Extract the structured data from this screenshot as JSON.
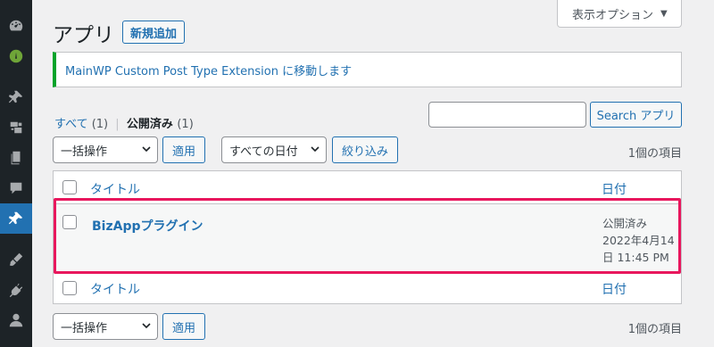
{
  "sidebar": {
    "items": [
      {
        "icon": "dashboard-icon"
      },
      {
        "icon": "mainwp-icon"
      },
      {
        "icon": "posts-pin-icon"
      },
      {
        "icon": "media-icon"
      },
      {
        "icon": "pages-icon"
      },
      {
        "icon": "comments-icon"
      },
      {
        "icon": "apps-pin-icon",
        "active": true
      },
      {
        "icon": "appearance-icon"
      },
      {
        "icon": "plugins-icon"
      },
      {
        "icon": "users-icon"
      }
    ],
    "active_color": "#2271b1"
  },
  "screen_options": {
    "label": "表示オプション",
    "arrow": "▼"
  },
  "header": {
    "title": "アプリ",
    "add_new_label": "新規追加"
  },
  "notice": {
    "text": "MainWP Custom Post Type Extension に移動します",
    "accent_color": "#00a32a"
  },
  "views": {
    "all": {
      "label": "すべて",
      "count": "(1)"
    },
    "separator": "|",
    "published": {
      "label": "公開済み",
      "count": "(1)"
    }
  },
  "search": {
    "value": "",
    "button_label": "Search アプリ"
  },
  "top_nav": {
    "bulk_action": "一括操作",
    "apply_label": "適用",
    "date_filter": "すべての日付",
    "filter_label": "絞り込み",
    "items_count": "1個の項目"
  },
  "table": {
    "columns": {
      "title": "タイトル",
      "date": "日付"
    },
    "rows": [
      {
        "title": "BizAppプラグイン",
        "status": "公開済み",
        "date_line1": "2022年4月14",
        "date_line2": "日 11:45 PM"
      }
    ]
  },
  "bottom_nav": {
    "bulk_action": "一括操作",
    "apply_label": "適用",
    "items_count": "1個の項目"
  },
  "highlight_color": "#e8175d"
}
